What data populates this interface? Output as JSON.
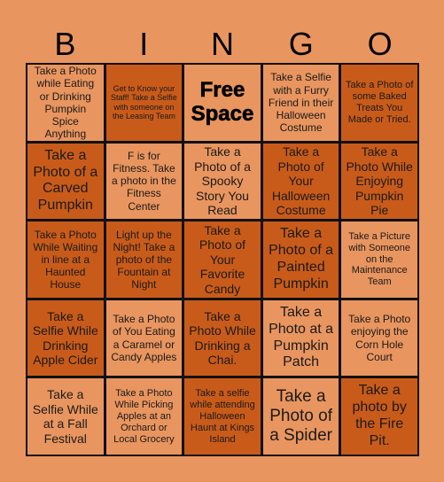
{
  "title_letters": [
    "B",
    "I",
    "N",
    "G",
    "O"
  ],
  "colors": {
    "background": "#E9955F",
    "light_cell": "#E9955F",
    "dark_cell": "#C95B1A",
    "grid_line": "#111111"
  },
  "cells": [
    {
      "text": "Take a Photo while Eating or Drinking Pumpkin Spice Anything",
      "shade": "light"
    },
    {
      "text": "Get to Know your Staff! Take a Selfie with someone on the Leasing Team",
      "shade": "dark"
    },
    {
      "text": "Free Space",
      "shade": "light",
      "free": true
    },
    {
      "text": "Take a Selfie with a Furry Friend in their Halloween Costume",
      "shade": "light"
    },
    {
      "text": "Take a Photo of some Baked Treats You Made or Tried.",
      "shade": "dark"
    },
    {
      "text": "Take a Photo of a Carved Pumpkin",
      "shade": "dark"
    },
    {
      "text": "F is for Fitness. Take a photo in the Fitness Center",
      "shade": "light"
    },
    {
      "text": "Take a Photo of a Spooky Story You Read",
      "shade": "light"
    },
    {
      "text": "Take a Photo of Your Halloween Costume",
      "shade": "dark"
    },
    {
      "text": "Take a Photo While Enjoying Pumpkin Pie",
      "shade": "dark"
    },
    {
      "text": "Take a Photo While Waiting in line at a Haunted House",
      "shade": "dark"
    },
    {
      "text": "Light up the Night! Take a photo of the Fountain at Night",
      "shade": "dark"
    },
    {
      "text": "Take a Photo of Your Favorite Candy",
      "shade": "dark"
    },
    {
      "text": "Take a Photo of a Painted Pumpkin",
      "shade": "dark"
    },
    {
      "text": "Take a Picture with Someone on the Maintenance Team",
      "shade": "light"
    },
    {
      "text": "Take a Selfie While Drinking Apple Cider",
      "shade": "dark"
    },
    {
      "text": "Take a Photo of You Eating a Caramel or Candy Apples",
      "shade": "light"
    },
    {
      "text": "Take a Photo While Drinking a Chai.",
      "shade": "dark"
    },
    {
      "text": "Take a Photo at a Pumpkin Patch",
      "shade": "light"
    },
    {
      "text": "Take a Photo enjoying the Corn Hole Court",
      "shade": "light"
    },
    {
      "text": "Take a Selfie While at a Fall Festival",
      "shade": "light"
    },
    {
      "text": "Take a Photo While Picking Apples at an Orchard or Local Grocery",
      "shade": "light"
    },
    {
      "text": "Take a selfie while attending Halloween Haunt at Kings Island",
      "shade": "dark"
    },
    {
      "text": "Take a Photo of a Spider",
      "shade": "light"
    },
    {
      "text": "Take a photo by the Fire Pit.",
      "shade": "dark"
    }
  ]
}
